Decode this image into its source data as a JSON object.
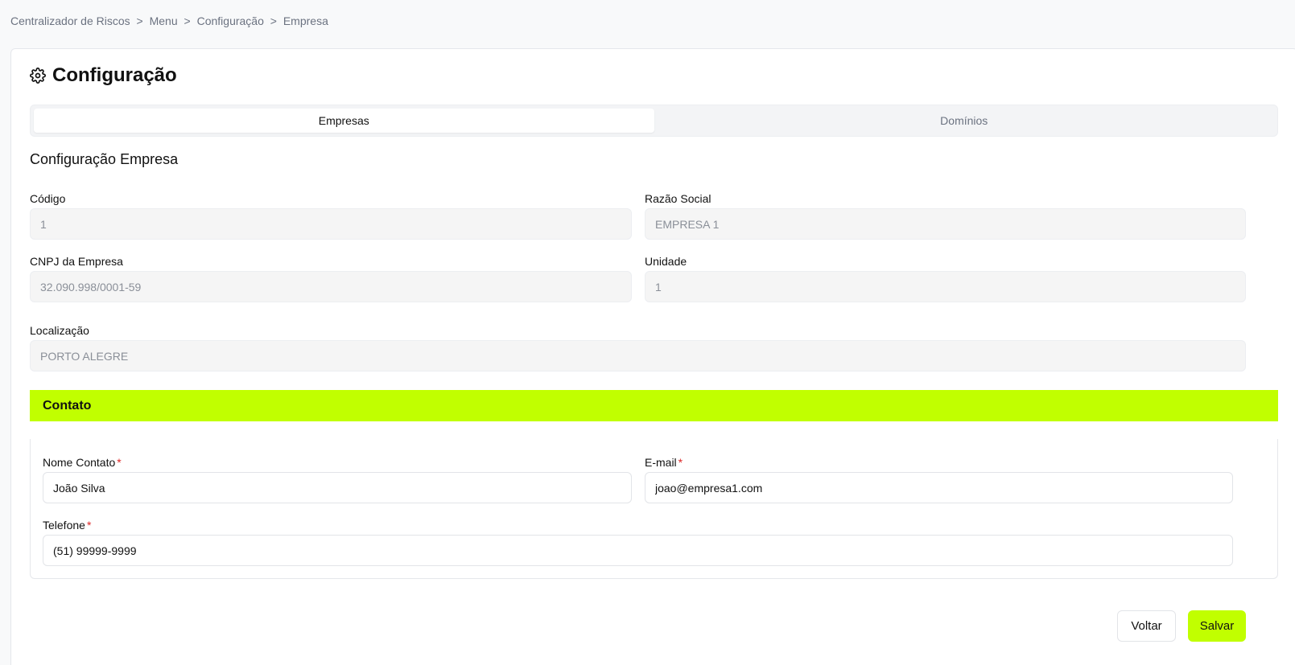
{
  "breadcrumb": [
    "Centralizador de Riscos",
    "Menu",
    "Configuração",
    "Empresa"
  ],
  "breadcrumb_separator": ">",
  "page": {
    "title": "Configuração",
    "icon": "gear-icon"
  },
  "tabs": [
    {
      "label": "Empresas",
      "active": true
    },
    {
      "label": "Domínios",
      "active": false
    }
  ],
  "form": {
    "section_title": "Configuração Empresa",
    "codigo": {
      "label": "Código",
      "value": "1"
    },
    "razao_social": {
      "label": "Razão Social",
      "value": "EMPRESA 1"
    },
    "cnpj": {
      "label": "CNPJ da Empresa",
      "value": "32.090.998/0001-59"
    },
    "unidade": {
      "label": "Unidade",
      "value": "1"
    },
    "localizacao": {
      "label": "Localização",
      "value": "PORTO ALEGRE"
    }
  },
  "contato": {
    "title": "Contato",
    "required_mark": "*",
    "nome": {
      "label": "Nome Contato",
      "value": "João Silva"
    },
    "email": {
      "label": "E-mail",
      "value": "joao@empresa1.com"
    },
    "telefone": {
      "label": "Telefone",
      "value": "(51) 99999-9999"
    }
  },
  "actions": {
    "back_label": "Voltar",
    "save_label": "Salvar"
  },
  "colors": {
    "accent": "#c1ff00",
    "required": "#dc2626"
  }
}
